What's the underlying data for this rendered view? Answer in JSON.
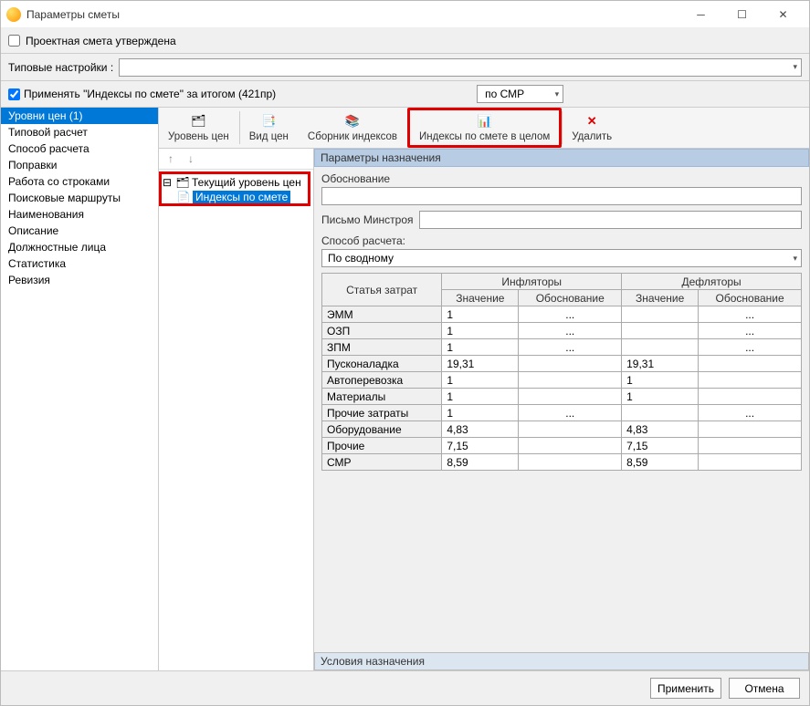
{
  "title": "Параметры сметы",
  "approved_label": "Проектная смета утверждена",
  "type_settings_label": "Типовые настройки :",
  "apply_indices_label": "Применять \"Индексы по смете\" за итогом (421пр)",
  "work_type_select": "по СМР",
  "sidebar": {
    "items": [
      "Уровни цен (1)",
      "Типовой расчет",
      "Способ расчета",
      "Поправки",
      "Работа со строками",
      "Поисковые маршруты",
      "Наименования",
      "Описание",
      "Должностные лица",
      "Статистика",
      "Ревизия"
    ]
  },
  "toolbar": {
    "level": "Уровень цен",
    "viewprices": "Вид цен",
    "collection": "Сборник индексов",
    "whole": "Индексы по смете в целом",
    "delete": "Удалить"
  },
  "tree": {
    "root": "Текущий уровень цен",
    "child": "Индексы по смете"
  },
  "params": {
    "header": "Параметры назначения",
    "justification": "Обоснование",
    "letter": "Письмо Минстроя",
    "method_label": "Способ расчета:",
    "method_value": "По сводному",
    "footer": "Условия назначения"
  },
  "table": {
    "col_article": "Статья затрат",
    "col_inflators": "Инфляторы",
    "col_deflators": "Дефляторы",
    "col_value": "Значение",
    "col_just": "Обоснование",
    "rows": [
      {
        "n": "ЭММ",
        "iv": "1",
        "ij": "",
        "dv": "",
        "dj": "...",
        "dots": true
      },
      {
        "n": "ОЗП",
        "iv": "1",
        "ij": "",
        "dv": "",
        "dj": "...",
        "dots": true
      },
      {
        "n": "ЗПМ",
        "iv": "1",
        "ij": "",
        "dv": "",
        "dj": "...",
        "dots": true
      },
      {
        "n": "Пусконаладка",
        "iv": "19,31",
        "ij": "",
        "dv": "19,31",
        "dj": ""
      },
      {
        "n": "Автоперевозка",
        "iv": "1",
        "ij": "",
        "dv": "1",
        "dj": ""
      },
      {
        "n": "Материалы",
        "iv": "1",
        "ij": "",
        "dv": "1",
        "dj": ""
      },
      {
        "n": "Прочие затраты",
        "iv": "1",
        "ij": "",
        "dv": "",
        "dj": "...",
        "dots": true
      },
      {
        "n": "Оборудование",
        "iv": "4,83",
        "ij": "",
        "dv": "4,83",
        "dj": ""
      },
      {
        "n": "Прочие",
        "iv": "7,15",
        "ij": "",
        "dv": "7,15",
        "dj": ""
      },
      {
        "n": "СМР",
        "iv": "8,59",
        "ij": "",
        "dv": "8,59",
        "dj": ""
      }
    ]
  },
  "footer": {
    "apply": "Применить",
    "cancel": "Отмена"
  }
}
